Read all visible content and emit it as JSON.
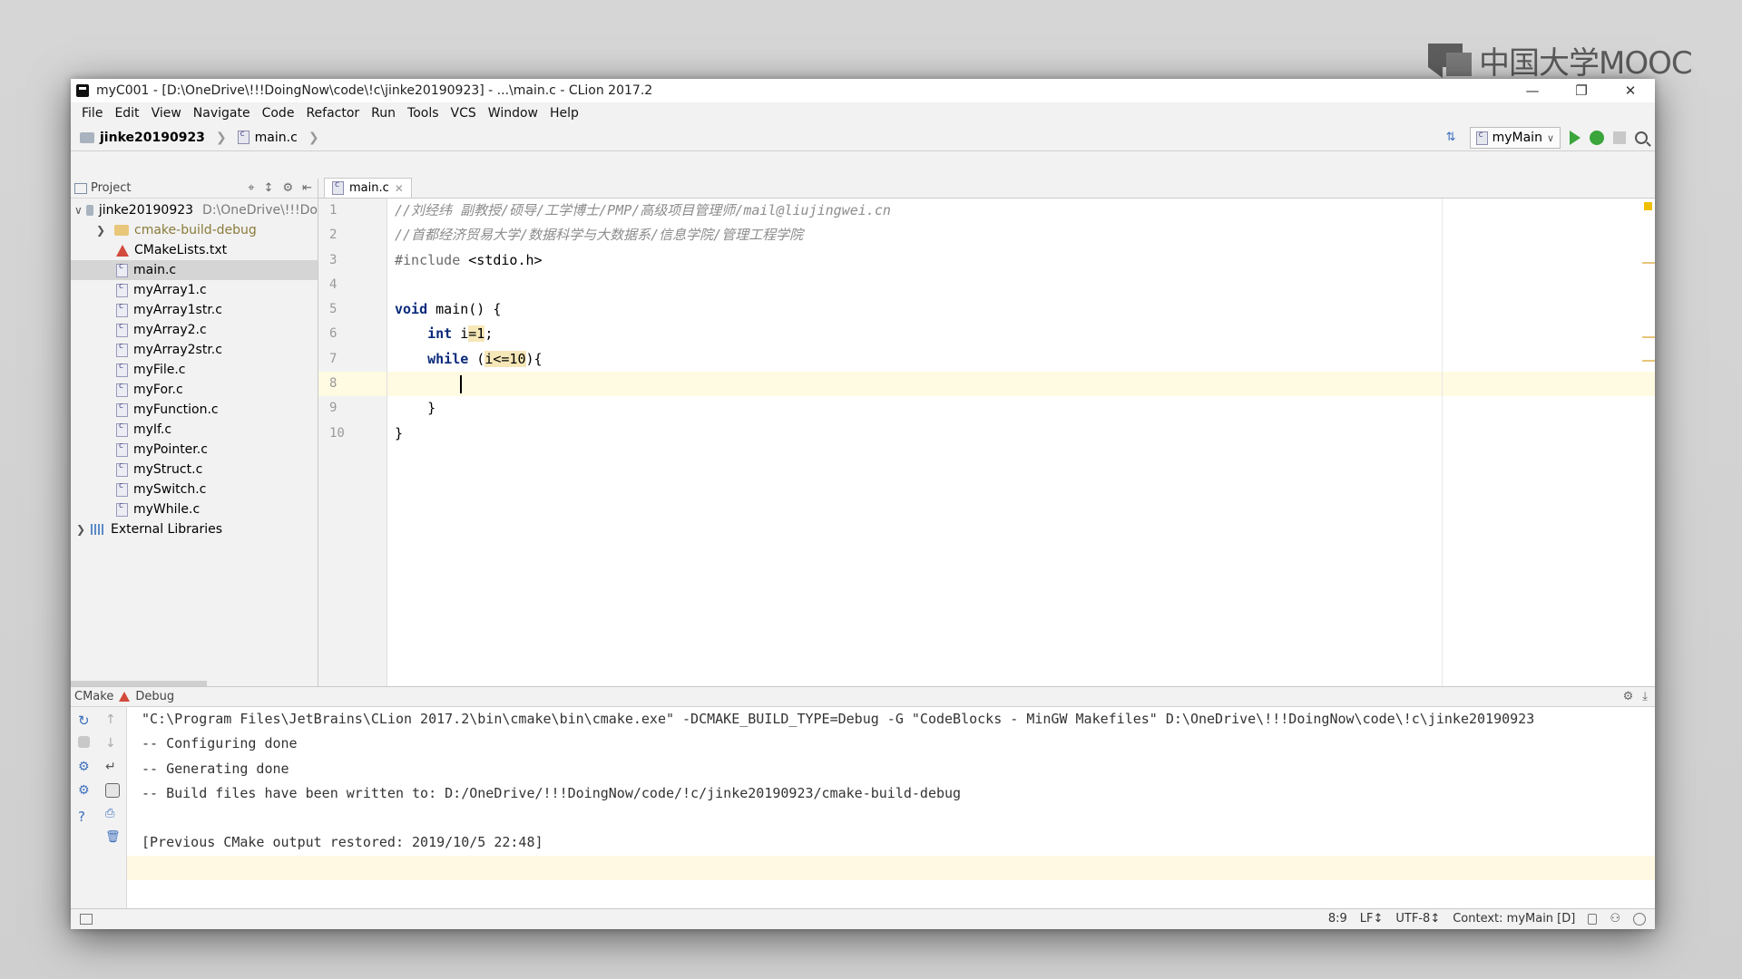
{
  "watermark": {
    "text": "中国大学MOOC"
  },
  "window": {
    "title": "myC001 - [D:\\OneDrive\\!!!DoingNow\\code\\!c\\jinke20190923] - ...\\main.c - CLion 2017.2",
    "minimize": "—",
    "restore": "❐",
    "close": "✕"
  },
  "menu": [
    "File",
    "Edit",
    "View",
    "Navigate",
    "Code",
    "Refactor",
    "Run",
    "Tools",
    "VCS",
    "Window",
    "Help"
  ],
  "breadcrumb": {
    "project": "jinke20190923",
    "file": "main.c"
  },
  "toolbar": {
    "run_config": "myMain"
  },
  "project_panel": {
    "title": "Project",
    "root": {
      "name": "jinke20190923",
      "path": "D:\\OneDrive\\!!!Do"
    },
    "items": [
      {
        "name": "cmake-build-debug",
        "kind": "folder"
      },
      {
        "name": "CMakeLists.txt",
        "kind": "cmake"
      },
      {
        "name": "main.c",
        "kind": "c",
        "selected": true
      },
      {
        "name": "myArray1.c",
        "kind": "c"
      },
      {
        "name": "myArray1str.c",
        "kind": "c"
      },
      {
        "name": "myArray2.c",
        "kind": "c"
      },
      {
        "name": "myArray2str.c",
        "kind": "c"
      },
      {
        "name": "myFile.c",
        "kind": "c"
      },
      {
        "name": "myFor.c",
        "kind": "c"
      },
      {
        "name": "myFunction.c",
        "kind": "c"
      },
      {
        "name": "myIf.c",
        "kind": "c"
      },
      {
        "name": "myPointer.c",
        "kind": "c"
      },
      {
        "name": "myStruct.c",
        "kind": "c"
      },
      {
        "name": "mySwitch.c",
        "kind": "c"
      },
      {
        "name": "myWhile.c",
        "kind": "c"
      }
    ],
    "external": "External Libraries"
  },
  "editor": {
    "tab": "main.c",
    "line_numbers": [
      "1",
      "2",
      "3",
      "4",
      "5",
      "6",
      "7",
      "8",
      "9",
      "10"
    ],
    "lines": {
      "l1": "//刘经纬 副教授/硕导/工学博士/PMP/高级项目管理师/mail@liujingwei.cn",
      "l2": "//首都经济贸易大学/数据科学与大数据系/信息学院/管理工程学院",
      "l3_pp": "#include ",
      "l3_hdr": "<stdio.h>",
      "l5_kw": "void",
      "l5_rest": " main() {",
      "l6_indent": "    ",
      "l6_kw": "int",
      "l6_a": " i",
      "l6_b": "=1",
      "l6_c": ";",
      "l7_indent": "    ",
      "l7_kw": "while",
      "l7_a": " (",
      "l7_b": "i<=10",
      "l7_c": "){",
      "l8_indent": "        ",
      "l9": "    }",
      "l10": "}"
    }
  },
  "cmake_panel": {
    "tab1": "CMake",
    "tab2": "Debug",
    "output": [
      "\"C:\\Program Files\\JetBrains\\CLion 2017.2\\bin\\cmake\\bin\\cmake.exe\" -DCMAKE_BUILD_TYPE=Debug -G \"CodeBlocks - MinGW Makefiles\" D:\\OneDrive\\!!!DoingNow\\code\\!c\\jinke20190923",
      "-- Configuring done",
      "-- Generating done",
      "-- Build files have been written to: D:/OneDrive/!!!DoingNow/code/!c/jinke20190923/cmake-build-debug",
      "",
      "[Previous CMake output restored: 2019/10/5 22:48]"
    ]
  },
  "status": {
    "position": "8:9",
    "line_sep": "LF↕",
    "encoding": "UTF-8↕",
    "context": "Context: myMain [D]"
  }
}
